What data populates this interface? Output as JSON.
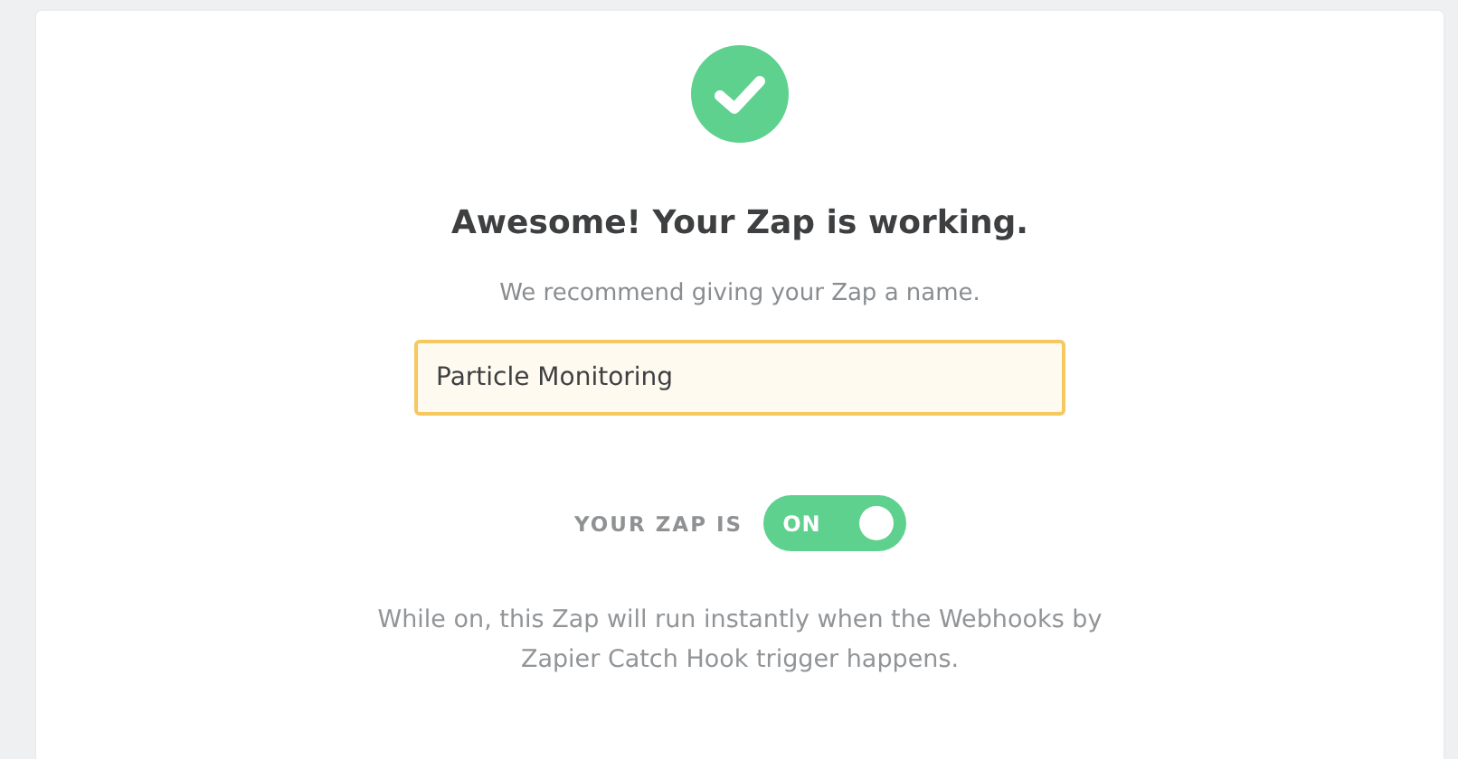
{
  "title": "Awesome! Your Zap is working.",
  "subtitle": "We recommend giving your Zap a name.",
  "name_field": {
    "value": "Particle Monitoring"
  },
  "status": {
    "label": "YOUR ZAP IS",
    "toggle_text": "ON",
    "on": true
  },
  "description": "While on, this Zap will run instantly when the Webhooks by Zapier Catch Hook trigger happens."
}
